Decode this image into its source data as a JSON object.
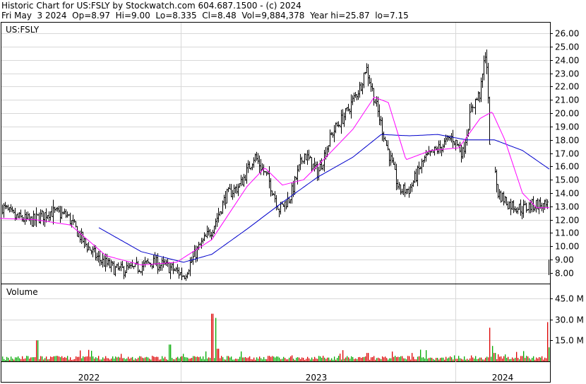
{
  "header": {
    "line1": "Historic Chart for US:FSLY by Stockwatch.com 604.687.1500 - (c) 2024",
    "line2": "Fri May  3 2024  Op=8.97  Hi=9.00  Lo=8.335  Cl=8.48  Vol=9,884,378  Year hi=25.87  lo=7.15"
  },
  "chart_data": [
    {
      "type": "line",
      "title": "US:FSLY",
      "series": [],
      "y_ticks": [
        "26.00",
        "25.00",
        "24.00",
        "23.00",
        "22.00",
        "21.00",
        "20.00",
        "19.00",
        "18.00",
        "17.00",
        "16.00",
        "15.00",
        "14.00",
        "13.00",
        "12.00",
        "11.00",
        "10.00",
        "9.00",
        "8.00"
      ],
      "ylim": [
        7.2,
        26.8
      ],
      "x_labels": [
        "2022",
        "2023",
        "2024"
      ],
      "grid": true,
      "price_anchors": [
        [
          0,
          13.1
        ],
        [
          20,
          12.2
        ],
        [
          45,
          11.9
        ],
        [
          70,
          12.6
        ],
        [
          95,
          12.3
        ],
        [
          120,
          10.2
        ],
        [
          140,
          9.0
        ],
        [
          165,
          8.2
        ],
        [
          190,
          8.3
        ],
        [
          215,
          8.8
        ],
        [
          240,
          8.4
        ],
        [
          260,
          7.8
        ],
        [
          280,
          9.8
        ],
        [
          300,
          11.3
        ],
        [
          320,
          13.8
        ],
        [
          340,
          14.6
        ],
        [
          360,
          16.8
        ],
        [
          380,
          15.0
        ],
        [
          395,
          12.8
        ],
        [
          410,
          13.6
        ],
        [
          430,
          17.0
        ],
        [
          450,
          15.5
        ],
        [
          470,
          18.5
        ],
        [
          490,
          20.0
        ],
        [
          510,
          22.0
        ],
        [
          518,
          23.5
        ],
        [
          528,
          21.5
        ],
        [
          545,
          18.0
        ],
        [
          565,
          14.2
        ],
        [
          580,
          14.3
        ],
        [
          600,
          16.5
        ],
        [
          620,
          17.3
        ],
        [
          640,
          18.2
        ],
        [
          655,
          17.0
        ],
        [
          668,
          20.5
        ],
        [
          680,
          21.5
        ],
        [
          688,
          25.0
        ],
        [
          693,
          18.0
        ],
        [
          705,
          14.0
        ],
        [
          720,
          13.2
        ],
        [
          740,
          12.8
        ],
        [
          760,
          13.2
        ],
        [
          775,
          12.9
        ]
      ],
      "ma_fast_anchors": [
        [
          0,
          12.1
        ],
        [
          50,
          12.0
        ],
        [
          100,
          11.6
        ],
        [
          150,
          9.3
        ],
        [
          200,
          8.6
        ],
        [
          250,
          8.8
        ],
        [
          300,
          10.5
        ],
        [
          350,
          14.5
        ],
        [
          375,
          15.9
        ],
        [
          400,
          14.6
        ],
        [
          430,
          15.0
        ],
        [
          460,
          16.6
        ],
        [
          500,
          18.8
        ],
        [
          530,
          21.2
        ],
        [
          550,
          20.8
        ],
        [
          575,
          16.5
        ],
        [
          610,
          17.2
        ],
        [
          650,
          17.4
        ],
        [
          680,
          19.6
        ],
        [
          697,
          20.1
        ],
        [
          715,
          18.0
        ],
        [
          740,
          14.0
        ],
        [
          760,
          12.9
        ],
        [
          778,
          12.9
        ]
      ],
      "ma_slow_anchors": [
        [
          140,
          11.4
        ],
        [
          200,
          9.6
        ],
        [
          260,
          8.8
        ],
        [
          300,
          9.4
        ],
        [
          350,
          11.3
        ],
        [
          400,
          13.3
        ],
        [
          450,
          15.2
        ],
        [
          500,
          16.7
        ],
        [
          540,
          18.4
        ],
        [
          580,
          18.3
        ],
        [
          620,
          18.4
        ],
        [
          660,
          18.0
        ],
        [
          700,
          18.0
        ],
        [
          740,
          17.2
        ],
        [
          778,
          15.8
        ]
      ],
      "ma_fast_color": "#ff00ff",
      "ma_slow_color": "#0000cc",
      "gap_bars": [
        {
          "hi": 9.0,
          "lo": 8.335,
          "close": 8.48
        }
      ]
    },
    {
      "type": "bar",
      "title": "Volume",
      "series": [],
      "y_ticks": [
        "45.0 M",
        "30.0 M",
        "15.0 M"
      ],
      "ylim": [
        0,
        55
      ],
      "baseline_million": 2.5,
      "spikes": [
        [
          52,
          15
        ],
        [
          240,
          12
        ],
        [
          300,
          34
        ],
        [
          305,
          31
        ],
        [
          308,
          9
        ],
        [
          485,
          8
        ],
        [
          520,
          6
        ],
        [
          555,
          7
        ],
        [
          603,
          8
        ],
        [
          693,
          24
        ],
        [
          697,
          11
        ],
        [
          700,
          6
        ],
        [
          776,
          28
        ],
        [
          778,
          10
        ]
      ],
      "up_color": "#00aa00",
      "down_color": "#dd0000"
    }
  ]
}
